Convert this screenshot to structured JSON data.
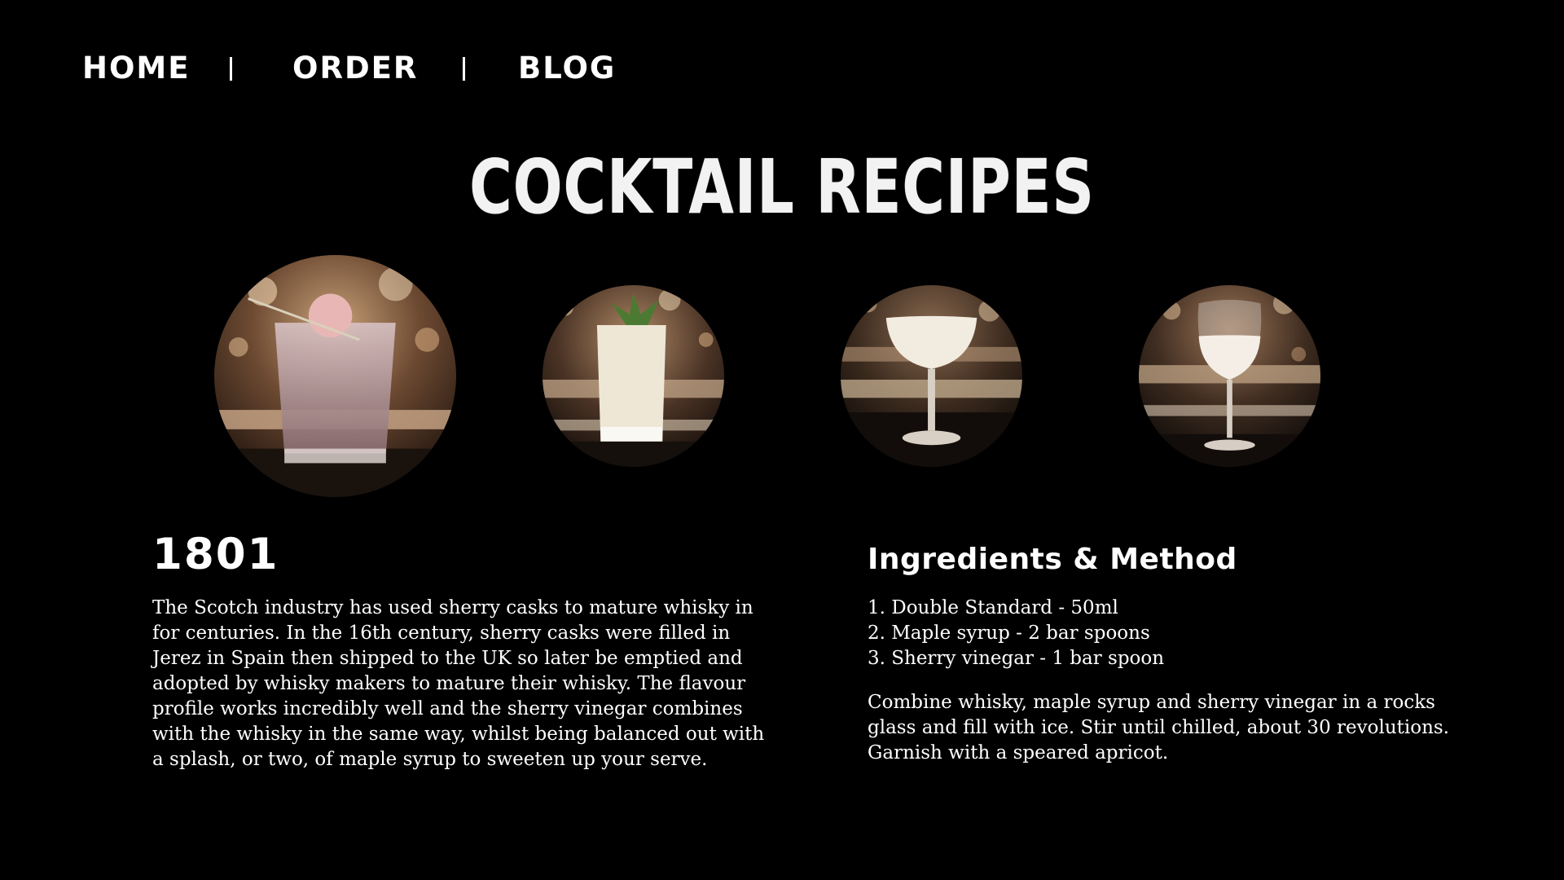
{
  "nav": {
    "home": "HOME",
    "order": "ORDER",
    "blog": "BLOG"
  },
  "page": {
    "title": "COCKTAIL RECIPES"
  },
  "drinks": [
    {
      "icon": "rocks-glass-cocktail-photo"
    },
    {
      "icon": "highball-cocktail-photo"
    },
    {
      "icon": "coupe-cocktail-photo"
    },
    {
      "icon": "wine-glass-cocktail-photo"
    }
  ],
  "recipe": {
    "name": "1801",
    "description": "The Scotch industry has used sherry casks to mature whisky in for centuries. In the 16th century, sherry casks were filled in Jerez in Spain then shipped to the UK so later be emptied and adopted by whisky makers to mature their whisky. The flavour profile works incredibly well and the sherry vinegar combines with the whisky in the same way, whilst being balanced out with a splash, or two, of maple syrup to sweeten up your serve.",
    "method_heading": "Ingredients & Method",
    "ingredients": [
      "1. Double Standard - 50ml",
      "2. Maple syrup - 2 bar spoons",
      "3. Sherry vinegar - 1 bar spoon"
    ],
    "method": "Combine whisky, maple syrup and sherry vinegar in a rocks glass and fill with ice. Stir until chilled, about 30 revolutions. Garnish with a speared apricot."
  },
  "colors": {
    "background": "#000000",
    "text": "#ffffff"
  }
}
